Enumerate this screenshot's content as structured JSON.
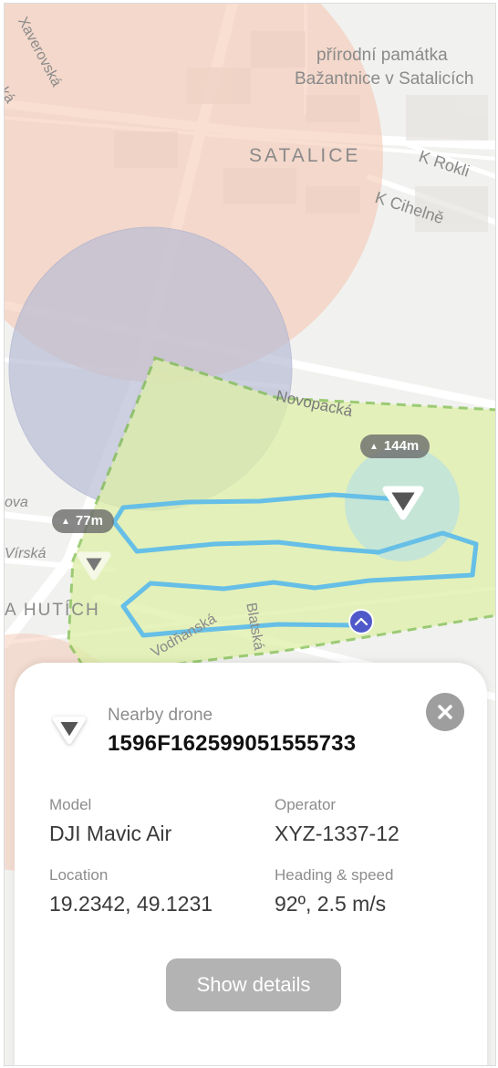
{
  "map": {
    "labels": {
      "poi_line1": "přírodní památka",
      "poi_line2": "Bažantnice v Satalicích",
      "satalice": "SATALICE",
      "k_rokli": "K Rokli",
      "k_cihelne": "K Cihelně",
      "novopacka": "Novopacká",
      "xaverovska": "Xaverovská",
      "ska": "ská",
      "ova": "ova",
      "virska": "Vírská",
      "hutich": "A HUTÍCH",
      "vodnanska": "Vodňanská",
      "blatska": "Blatská"
    },
    "drones": [
      {
        "altitude": "144m",
        "icon": "drone-marker-icon"
      },
      {
        "altitude": "77m",
        "icon": "drone-marker-icon"
      }
    ],
    "user_location_icon": "chevron-up-icon",
    "colors": {
      "restricted_zone": "#f4c3ad",
      "control_zone": "#b9bdd4",
      "permitted_area": "#dff0a8",
      "permitted_border": "#7fbe4c",
      "flight_path": "#66bfe6",
      "drone_halo": "#bfe3dc",
      "user_location": "#5059c9"
    }
  },
  "card": {
    "subtitle": "Nearby drone",
    "drone_id": "1596F162599051555733",
    "icon": "drone-marker-icon",
    "close_icon": "close-icon",
    "fields": [
      {
        "label": "Model",
        "value": "DJI Mavic Air"
      },
      {
        "label": "Operator",
        "value": "XYZ-1337-12"
      },
      {
        "label": "Location",
        "value": "19.2342, 49.1231"
      },
      {
        "label": "Heading & speed",
        "value": "92º, 2.5 m/s"
      }
    ],
    "details_button": "Show details"
  }
}
